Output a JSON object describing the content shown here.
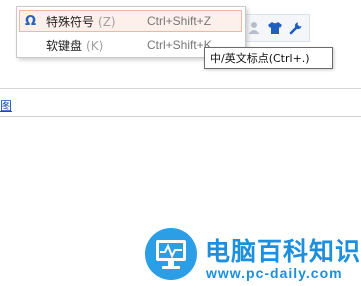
{
  "page": {
    "link_fragment": "图"
  },
  "menu": {
    "items": [
      {
        "icon": "Ω",
        "label": "特殊符号",
        "key": "(Z)",
        "shortcut": "Ctrl+Shift+Z"
      },
      {
        "icon": "",
        "label": "软键盘",
        "key": "(K)",
        "shortcut": "Ctrl+Shift+K"
      }
    ]
  },
  "toolbar": {
    "icons": [
      "user-icon",
      "shirt-icon",
      "wrench-icon"
    ]
  },
  "tooltip": {
    "text": "中/英文标点(Ctrl+.)"
  },
  "watermark": {
    "title": "电脑百科知识",
    "url": "www.pc-daily.com"
  },
  "colors": {
    "accent_blue": "#2a62b8",
    "menu_highlight_bg": "#fdf0eb",
    "menu_highlight_border": "#f0b7a2",
    "watermark_blue": "#1d8fdc"
  }
}
